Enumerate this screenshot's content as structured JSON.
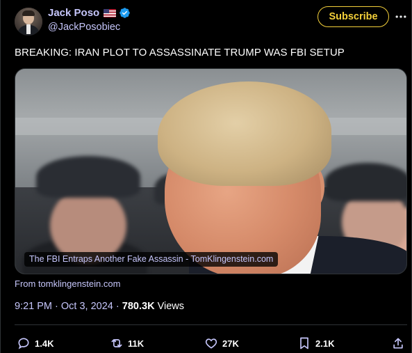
{
  "author": {
    "display_name": "Jack Poso",
    "handle": "@JackPosobiec"
  },
  "header": {
    "subscribe_label": "Subscribe"
  },
  "tweet": {
    "text": "BREAKING: IRAN PLOT TO ASSASSINATE TRUMP WAS FBI SETUP"
  },
  "media": {
    "caption": "The FBI Entraps Another Fake Assassin - TomKlingenstein.com",
    "source": "From tomklingenstein.com"
  },
  "meta": {
    "time": "9:21 PM",
    "date": "Oct 3, 2024",
    "separator": "·",
    "views_count": "780.3K",
    "views_label": "Views"
  },
  "actions": {
    "replies": "1.4K",
    "reposts": "11K",
    "likes": "27K",
    "bookmarks": "2.1K"
  },
  "colors": {
    "background": "#000000",
    "link": "#c6c6fb",
    "accent": "#f4d03a",
    "verified": "#1d9bf0",
    "flag_red": "#b22234",
    "flag_blue": "#3c3b6e"
  },
  "icons": [
    "avatar",
    "us-flag-icon",
    "verified-icon",
    "more-icon",
    "reply-icon",
    "repost-icon",
    "like-icon",
    "bookmark-icon",
    "share-icon"
  ]
}
